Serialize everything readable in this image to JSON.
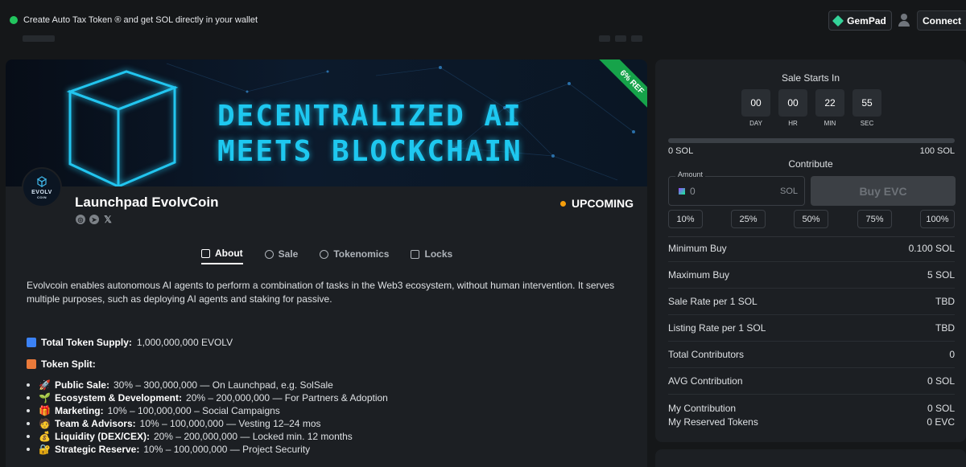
{
  "topbar": {
    "notice": "Create Auto Tax Token ® and get SOL directly in your wallet",
    "gempad_label": "GemPad",
    "connect_label": "Connect"
  },
  "banner": {
    "line1": "DECENTRALIZED AI",
    "line2": "MEETS BLOCKCHAIN",
    "ribbon": "6% REF"
  },
  "project": {
    "logo_text": "EVOLV",
    "logo_sub": "COIN",
    "title": "Launchpad EvolvCoin",
    "status": "UPCOMING",
    "status_color": "#f59e0b"
  },
  "tabs": [
    {
      "label": "About",
      "icon": "book-icon"
    },
    {
      "label": "Sale",
      "icon": "info-icon"
    },
    {
      "label": "Tokenomics",
      "icon": "pie-chart-icon"
    },
    {
      "label": "Locks",
      "icon": "lock-icon"
    }
  ],
  "about": {
    "description": "Evolvcoin enables autonomous AI agents to perform a combination of tasks in the Web3 ecosystem, without human intervention. It serves multiple purposes, such as deploying AI agents and staking for passive.",
    "supply_label": "Total Token Supply:",
    "supply_value": "1,000,000,000 EVOLV",
    "split_label": "Token Split:",
    "split": [
      {
        "emoji": "🚀",
        "label": "Public Sale:",
        "text": "30% – 300,000,000 — On Launchpad, e.g. SolSale"
      },
      {
        "emoji": "🌱",
        "label": "Ecosystem & Development:",
        "text": "20% – 200,000,000 — For Partners & Adoption"
      },
      {
        "emoji": "🎁",
        "label": "Marketing:",
        "text": "10% – 100,000,000 – Social Campaigns"
      },
      {
        "emoji": "🧑",
        "label": "Team & Advisors:",
        "text": "10% – 100,000,000 — Vesting 12–24 mos"
      },
      {
        "emoji": "💰",
        "label": "Liquidity (DEX/CEX):",
        "text": "20% – 200,000,000 — Locked min. 12 months"
      },
      {
        "emoji": "🔐",
        "label": "Strategic Reserve:",
        "text": "10% – 100,000,000 — Project Security"
      }
    ]
  },
  "sale": {
    "starts_label": "Sale Starts In",
    "countdown": [
      {
        "value": "00",
        "unit": "DAY"
      },
      {
        "value": "00",
        "unit": "HR"
      },
      {
        "value": "22",
        "unit": "MIN"
      },
      {
        "value": "55",
        "unit": "SEC"
      }
    ],
    "progress_fraction": 0,
    "progress_min": "0 SOL",
    "progress_max": "100 SOL",
    "contribute_label": "Contribute",
    "amount_label": "Amount",
    "amount_value": "0",
    "amount_unit": "SOL",
    "buy_label": "Buy EVC",
    "percent_buttons": [
      "10%",
      "25%",
      "50%",
      "75%",
      "100%"
    ],
    "info": [
      {
        "label": "Minimum Buy",
        "value": "0.100 SOL"
      },
      {
        "label": "Maximum Buy",
        "value": "5 SOL"
      },
      {
        "label": "Sale Rate per 1 SOL",
        "value": "TBD"
      },
      {
        "label": "Listing Rate per 1 SOL",
        "value": "TBD"
      },
      {
        "label": "Total Contributors",
        "value": "0"
      },
      {
        "label": "AVG Contribution",
        "value": "0 SOL"
      },
      {
        "label": "My Contribution",
        "value": "0 SOL"
      },
      {
        "label": "My Reserved Tokens",
        "value": "0 EVC"
      }
    ]
  }
}
